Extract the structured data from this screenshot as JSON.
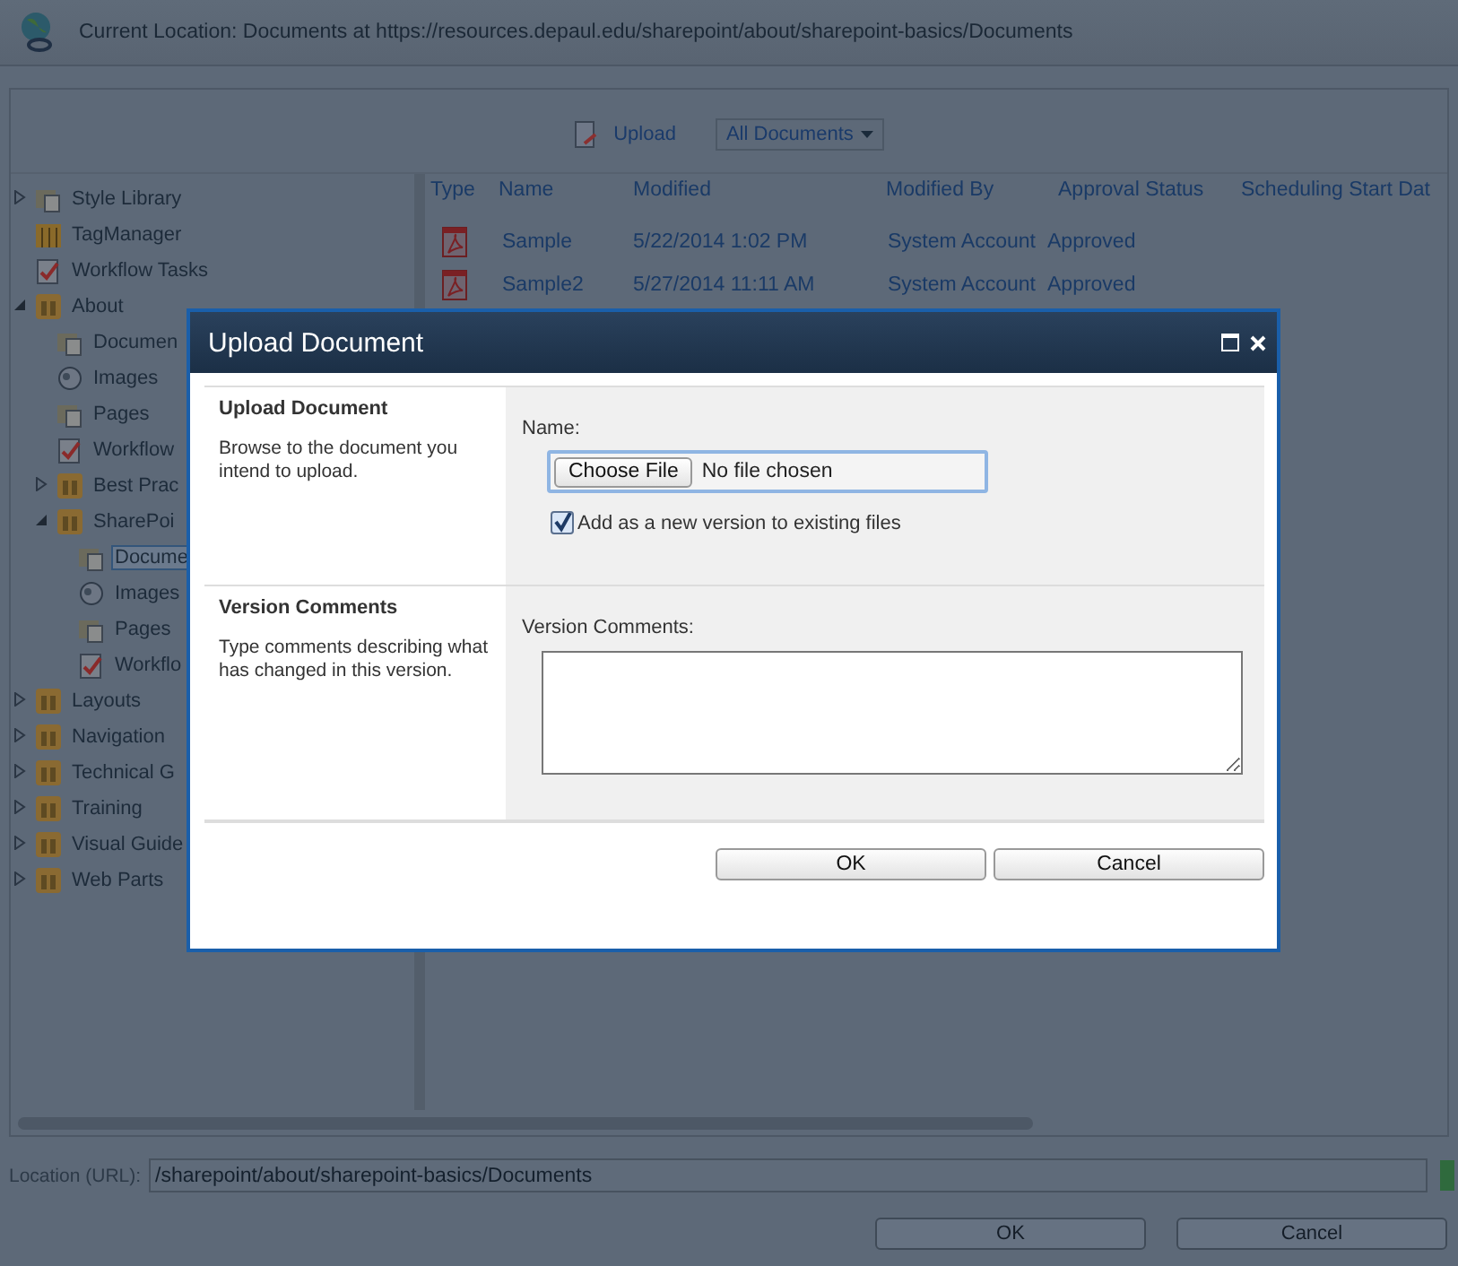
{
  "location_header": "Current Location: Documents at https://resources.depaul.edu/sharepoint/about/sharepoint-basics/Documents",
  "toolbar": {
    "upload": "Upload",
    "view": "All Documents"
  },
  "tree": [
    {
      "label": "Style Library",
      "kind": "library",
      "expanded": false,
      "selected": false
    },
    {
      "label": "TagManager",
      "kind": "tag",
      "selected": false
    },
    {
      "label": "Workflow Tasks",
      "kind": "tasks",
      "selected": false
    },
    {
      "label": "About",
      "kind": "site",
      "expanded": true,
      "selected": false,
      "children": [
        {
          "label": "Documen",
          "kind": "library",
          "selected": false
        },
        {
          "label": "Images",
          "kind": "images",
          "selected": false
        },
        {
          "label": "Pages",
          "kind": "library",
          "selected": false
        },
        {
          "label": "Workflow",
          "kind": "tasks",
          "selected": false
        },
        {
          "label": "Best Prac",
          "kind": "site",
          "expanded": false,
          "selected": false
        },
        {
          "label": "SharePoi",
          "kind": "site",
          "expanded": true,
          "selected": false,
          "children": [
            {
              "label": "Docume",
              "kind": "library",
              "selected": true
            },
            {
              "label": "Images",
              "kind": "images",
              "selected": false
            },
            {
              "label": "Pages",
              "kind": "library",
              "selected": false
            },
            {
              "label": "Workflo",
              "kind": "tasks",
              "selected": false
            }
          ]
        }
      ]
    },
    {
      "label": "Layouts",
      "kind": "site",
      "expanded": false,
      "selected": false
    },
    {
      "label": "Navigation",
      "kind": "site",
      "expanded": false,
      "selected": false
    },
    {
      "label": "Technical G",
      "kind": "site",
      "expanded": false,
      "selected": false
    },
    {
      "label": "Training",
      "kind": "site",
      "expanded": false,
      "selected": false
    },
    {
      "label": "Visual Guide",
      "kind": "site",
      "expanded": false,
      "selected": false
    },
    {
      "label": "Web Parts",
      "kind": "site",
      "expanded": false,
      "selected": false
    }
  ],
  "table": {
    "columns": [
      "Type",
      "Name",
      "Modified",
      "Modified By",
      "Approval Status",
      "Scheduling Start Dat"
    ],
    "rows": [
      {
        "name": "Sample",
        "modified": "5/22/2014 1:02 PM",
        "modified_by": "System Account",
        "approval_status": "Approved"
      },
      {
        "name": "Sample2",
        "modified": "5/27/2014 11:11 AM",
        "modified_by": "System Account",
        "approval_status": "Approved"
      }
    ]
  },
  "location_field": {
    "label": "Location (URL):",
    "value": "/sharepoint/about/sharepoint-basics/Documents"
  },
  "footer_buttons": [
    "OK",
    "Cancel"
  ],
  "dialog": {
    "title": "Upload Document",
    "sections": [
      {
        "heading": "Upload Document",
        "description": "Browse to the document you intend to upload.",
        "kind": "file"
      },
      {
        "heading": "Version Comments",
        "description": "Type comments describing what has changed in this version.",
        "kind": "comments"
      }
    ],
    "name_label": "Name:",
    "choose_file": "Choose File",
    "no_file": "No file chosen",
    "add_version": {
      "label": "Add as a new version to existing files",
      "checked": true
    },
    "comments_label": "Version Comments:",
    "buttons": [
      "OK",
      "Cancel"
    ]
  }
}
